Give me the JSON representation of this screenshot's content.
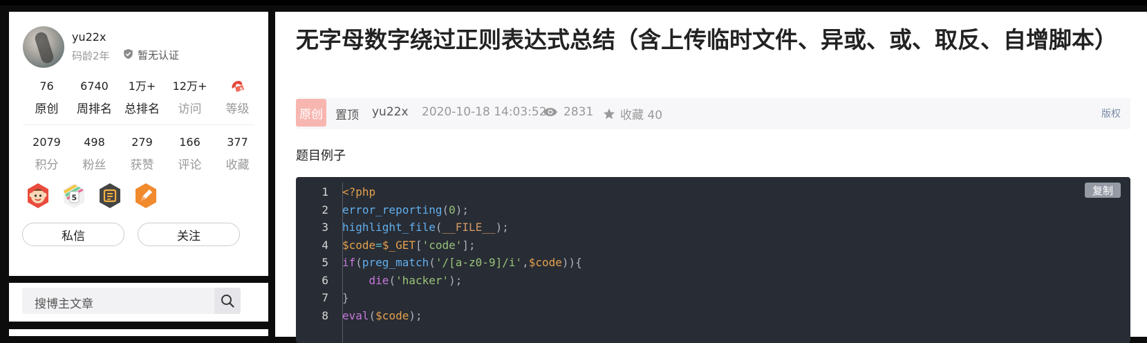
{
  "profile": {
    "username": "yu22x",
    "code_age": "码龄2年",
    "verify": "暂无认证",
    "stats_row1": [
      {
        "num": "76",
        "label": "原创"
      },
      {
        "num": "6740",
        "label": "周排名"
      },
      {
        "num": "1万+",
        "label": "总排名"
      },
      {
        "num": "12万+",
        "label": "访问"
      },
      {
        "num": "",
        "label": "等级",
        "icon": "level-icon"
      }
    ],
    "stats_row2": [
      {
        "num": "2079",
        "label": "积分"
      },
      {
        "num": "498",
        "label": "粉丝"
      },
      {
        "num": "279",
        "label": "获赞"
      },
      {
        "num": "166",
        "label": "评论"
      },
      {
        "num": "377",
        "label": "收藏"
      }
    ],
    "badges": [
      "monkey-badge-icon",
      "five-badge-icon",
      "blog-badge-icon",
      "pen-badge-icon"
    ],
    "message_btn": "私信",
    "follow_btn": "关注"
  },
  "search": {
    "placeholder": "搜博主文章"
  },
  "article": {
    "title": "无字母数字绕过正则表达式总结（含上传临时文件、异或、或、取反、自增脚本）",
    "original_tag": "原创",
    "pinned": "置顶",
    "author": "yu22x",
    "date": "2020-10-18 14:03:52",
    "views": "2831",
    "favorites": "收藏 40",
    "rights": "版权",
    "paragraph": "题目例子",
    "copy_btn": "复制",
    "code_line_numbers": [
      "1",
      "2",
      "3",
      "4",
      "5",
      "6",
      "7",
      "8"
    ],
    "code_lines": [
      "<?php",
      "error_reporting(0);",
      "highlight_file(__FILE__);",
      "$code=$_GET['code'];",
      "if(preg_match('/[a-z0-9]/i',$code)){",
      "    die('hacker');",
      "}",
      "eval($code);"
    ]
  },
  "colors": {
    "page_bg": "#0c0c0c",
    "card_bg": "#ffffff",
    "code_bg": "#282c34",
    "original_tag_bg": "#f8b6b0",
    "rights": "#7a8ba5"
  }
}
